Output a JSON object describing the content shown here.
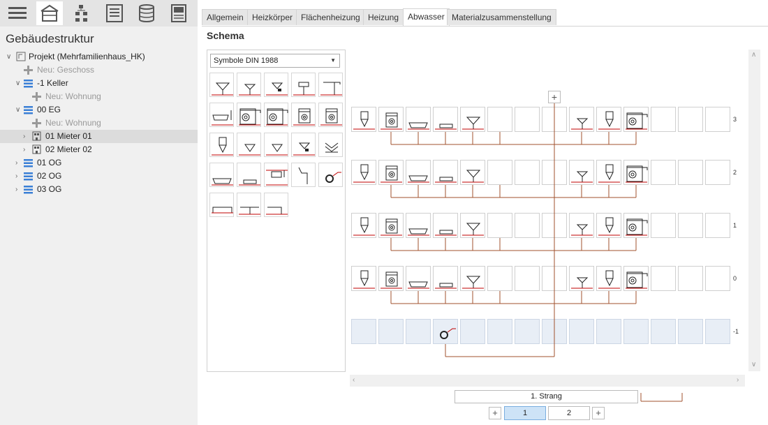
{
  "toolbar": {
    "icons": [
      "menu-icon",
      "building-icon",
      "hierarchy-icon",
      "list-icon",
      "database-icon",
      "report-icon"
    ],
    "active_index": 1
  },
  "tree": {
    "title": "Gebäudestruktur",
    "nodes": [
      {
        "label": "Projekt (Mehrfamilienhaus_HK)",
        "type": "project",
        "expanded": true
      },
      {
        "label": "Neu: Geschoss",
        "type": "add"
      },
      {
        "label": "-1 Keller",
        "type": "floor",
        "expanded": true
      },
      {
        "label": "Neu: Wohnung",
        "type": "add"
      },
      {
        "label": "00 EG",
        "type": "floor",
        "expanded": true
      },
      {
        "label": "Neu: Wohnung",
        "type": "add"
      },
      {
        "label": "01 Mieter 01",
        "type": "apartment",
        "selected": true
      },
      {
        "label": "02 Mieter 02",
        "type": "apartment"
      },
      {
        "label": "01 OG",
        "type": "floor"
      },
      {
        "label": "02 OG",
        "type": "floor"
      },
      {
        "label": "03 OG",
        "type": "floor"
      }
    ]
  },
  "tabs": [
    {
      "label": "Allgemein"
    },
    {
      "label": "Heizkörper"
    },
    {
      "label": "Flächenheizung"
    },
    {
      "label": "Heizung"
    },
    {
      "label": "Abwasser",
      "active": true
    },
    {
      "label": "Materialzusammenstellung"
    }
  ],
  "schema": {
    "title": "Schema",
    "symbol_select": "Symbole DIN 1988",
    "floor_labels": [
      "3",
      "2",
      "1",
      "0",
      "-1"
    ],
    "strang_label": "1. Strang",
    "pages": [
      "1",
      "2"
    ],
    "active_page": "1",
    "plus": "+"
  },
  "colors": {
    "pipe": "#a0522d",
    "accent": "#c00000",
    "selected_page": "#cde3f7",
    "base_row": "#e8eef6"
  }
}
